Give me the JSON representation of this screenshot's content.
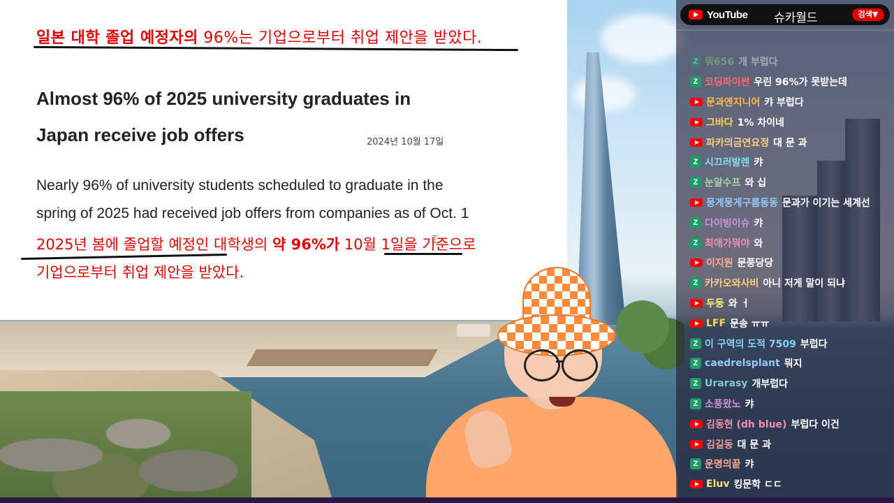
{
  "slide": {
    "korean_title_bold": "일본 대학 졸업 예정자의",
    "korean_title_rest": " 96%는 기업으로부터 취업 제안을 받았다.",
    "headline_line1": "Almost 96% of 2025 university graduates in",
    "headline_line2": "Japan receive job offers",
    "date": "2024년 10월 17일",
    "body_en_line1": "Nearly 96% of university students scheduled to graduate in the",
    "body_en_line2": "spring of 2025 had received job offers from companies as of Oct. 1",
    "body_kr_part1": "2025년 봄에 졸업할 예정인 대학생의 ",
    "body_kr_bold": "약 96%가",
    "body_kr_part2": " 10월 1일을 기준으로",
    "body_kr_line2": "기업으로부터 취업 제안을 받았다."
  },
  "chat": {
    "platform": "YouTube",
    "channel": "슈카월드",
    "search_label": "검색▼",
    "messages": [
      {
        "badge": "zz",
        "name": "뭐656",
        "text": "개 부럽다",
        "color": "#9ad37a"
      },
      {
        "badge": "zz",
        "name": "코딩파이썬",
        "text": "우린 96%가 못받는데",
        "color": "#ff6b6b"
      },
      {
        "badge": "yt",
        "name": "문과엔지니어",
        "text": "캬 부럽다",
        "color": "#ffb74d"
      },
      {
        "badge": "yt",
        "name": "그바다",
        "text": "1% 차이네",
        "color": "#ffd54f"
      },
      {
        "badge": "yt",
        "name": "파카의금연요정",
        "text": "대 문 과",
        "color": "#ffcc80"
      },
      {
        "badge": "zz",
        "name": "시끄러발렌",
        "text": "캬",
        "color": "#80deea"
      },
      {
        "badge": "zz",
        "name": "눈알수프",
        "text": "와 십",
        "color": "#a5d6a7"
      },
      {
        "badge": "yt",
        "name": "뭉게뭉게구름동동",
        "text": "문과가 이기는 세계선",
        "color": "#90caf9"
      },
      {
        "badge": "zz",
        "name": "다이빙이슈",
        "text": "캬",
        "color": "#ce93d8"
      },
      {
        "badge": "zz",
        "name": "최애가뭐야",
        "text": "와",
        "color": "#f48fb1"
      },
      {
        "badge": "yt",
        "name": "이지원",
        "text": "문풍당당",
        "color": "#ffab91"
      },
      {
        "badge": "zz",
        "name": "카카오와사비",
        "text": "아니 저게 말이 되냐",
        "color": "#ffcc80"
      },
      {
        "badge": "yt",
        "name": "두둥",
        "text": "와 ㅓ",
        "color": "#fff176"
      },
      {
        "badge": "yt",
        "name": "LFF",
        "text": "문송 ㅠㅠ",
        "color": "#ffd54f"
      },
      {
        "badge": "zz",
        "name": "이 구역의 도적 7509",
        "text": "부럽다",
        "color": "#81d4fa"
      },
      {
        "badge": "zz",
        "name": "caedrelsplant",
        "text": "뭐지",
        "color": "#90caf9"
      },
      {
        "badge": "zz",
        "name": "Urarasy",
        "text": "개부럽다",
        "color": "#80cbc4"
      },
      {
        "badge": "zz",
        "name": "소풍왔노",
        "text": "캬",
        "color": "#ce93d8"
      },
      {
        "badge": "yt",
        "name": "김동현 (dh blue)",
        "text": "부럽다 이건",
        "color": "#f48fb1"
      },
      {
        "badge": "yt",
        "name": "김길동",
        "text": "대 문 과",
        "color": "#ef9a9a"
      },
      {
        "badge": "zz",
        "name": "운명의끝",
        "text": "캬",
        "color": "#ffab91"
      },
      {
        "badge": "yt",
        "name": "Eluv",
        "text": "킹문학 ㄷㄷ",
        "color": "#ffe082"
      }
    ]
  }
}
